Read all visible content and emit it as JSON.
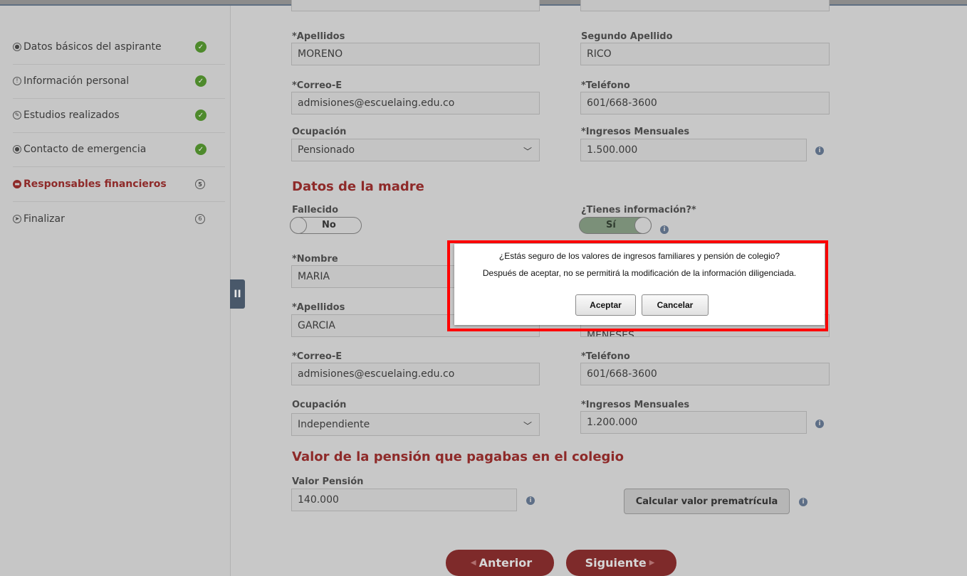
{
  "sidebar": {
    "items": [
      {
        "label": "Datos básicos del aspirante",
        "icon": "user-circle-icon",
        "status": "complete"
      },
      {
        "label": "Información personal",
        "icon": "exclamation-circle-icon",
        "status": "complete"
      },
      {
        "label": "Estudios realizados",
        "icon": "pencil-circle-icon",
        "status": "complete"
      },
      {
        "label": "Contacto de emergencia",
        "icon": "contact-circle-icon",
        "status": "complete"
      },
      {
        "label": "Responsables financieros",
        "icon": "wallet-icon",
        "status": "5",
        "active": true
      },
      {
        "label": "Finalizar",
        "icon": "paper-plane-icon",
        "status": "6"
      }
    ]
  },
  "padre": {
    "apellidos_label": "*Apellidos",
    "apellidos_value": "MORENO",
    "segundo_apellido_label": "Segundo Apellido",
    "segundo_apellido_value": "RICO",
    "correo_label": "*Correo-E",
    "correo_value": "admisiones@escuelaing.edu.co",
    "telefono_label": "*Teléfono",
    "telefono_value": "601/668-3600",
    "ocupacion_label": "Ocupación",
    "ocupacion_value": "Pensionado",
    "ingresos_label": "*Ingresos Mensuales",
    "ingresos_value": "1.500.000"
  },
  "madre": {
    "section_title": "Datos de la madre",
    "fallecido_label": "Fallecido",
    "fallecido_value": "No",
    "tiene_info_label": "¿Tienes información?*",
    "tiene_info_value": "Sí",
    "nombre_label": "*Nombre",
    "nombre_value": "MARIA",
    "apellidos_label": "*Apellidos",
    "apellidos_value": "GARCIA",
    "segundo_apellido_partial": "MENESES",
    "correo_label": "*Correo-E",
    "correo_value": "admisiones@escuelaing.edu.co",
    "telefono_label": "*Teléfono",
    "telefono_value": "601/668-3600",
    "ocupacion_label": "Ocupación",
    "ocupacion_value": "Independiente",
    "ingresos_label": "*Ingresos Mensuales",
    "ingresos_value": "1.200.000"
  },
  "pension": {
    "section_title": "Valor de la pensión que pagabas en el colegio",
    "valor_label": "Valor Pensión",
    "valor_value": "140.000",
    "calcular_button": "Calcular valor prematrícula"
  },
  "nav": {
    "anterior": "Anterior",
    "siguiente": "Siguiente"
  },
  "dialog": {
    "line1": "¿Estás seguro de los valores de ingresos familiares y pensión de colegio?",
    "line2": "Después de aceptar, no se permitirá la modificación de la información diligenciada.",
    "aceptar": "Aceptar",
    "cancelar": "Cancelar"
  },
  "collapse_label": "II",
  "colors": {
    "accent": "#8e2a29",
    "success": "#4e8a2c",
    "highlight": "#ff0000"
  }
}
